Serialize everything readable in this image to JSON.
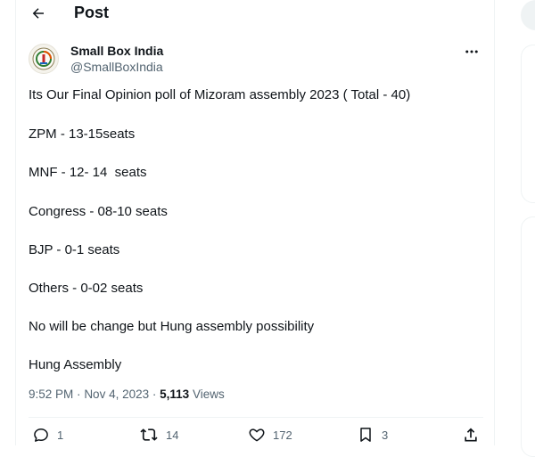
{
  "header": {
    "title": "Post"
  },
  "author": {
    "display_name": "Small Box India",
    "handle": "@SmallBoxIndia"
  },
  "tweet": {
    "lines": [
      "Its Our Final Opinion poll of Mizoram assembly 2023 ( Total - 40)",
      "ZPM - 13-15seats",
      "MNF - 12- 14  seats",
      "Congress - 08-10 seats",
      "BJP - 0-1 seats",
      "Others - 0-02 seats",
      "No will be change but Hung assembly possibility",
      "Hung Assembly"
    ]
  },
  "meta": {
    "time": "9:52 PM",
    "date": "Nov 4, 2023",
    "views_count": "5,113",
    "views_label": "Views",
    "separator": "·"
  },
  "actions": {
    "replies": "1",
    "reposts": "14",
    "likes": "172",
    "bookmarks": "3"
  },
  "icons": {
    "back": "arrow-left-icon",
    "more": "more-horizontal-icon",
    "reply": "reply-icon",
    "repost": "repost-icon",
    "like": "heart-icon",
    "bookmark": "bookmark-icon",
    "share": "share-icon"
  },
  "colors": {
    "text": "#0f1419",
    "secondary": "#536471",
    "border": "#eff3f4"
  }
}
